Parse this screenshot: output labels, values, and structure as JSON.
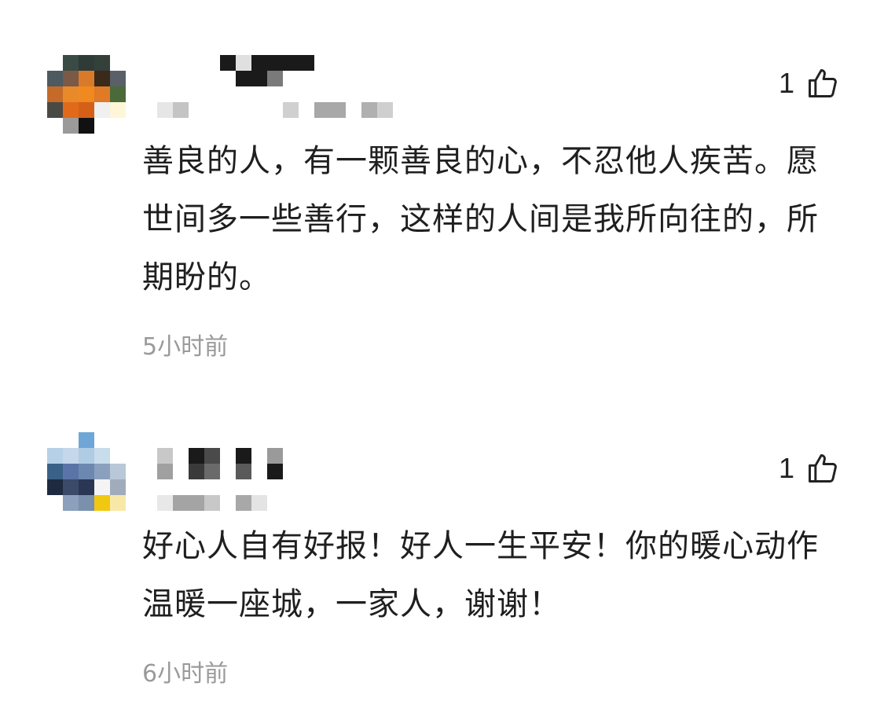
{
  "comments": [
    {
      "like_count": "1",
      "text": "善良的人，有一颗善良的心，不忍他人疾苦。愿世间多一些善行，这样的人间是我所向往的，所期盼的。",
      "time": "5小时前"
    },
    {
      "like_count": "1",
      "text": "好心人自有好报！好人一生平安！你的暖心动作温暖一座城，一家人，谢谢！",
      "time": "6小时前"
    }
  ],
  "icons": {
    "like": "thumbs-up-icon"
  },
  "colors": {
    "text": "#1f1f1f",
    "timestamp": "#9a9a9a",
    "background": "#ffffff"
  }
}
